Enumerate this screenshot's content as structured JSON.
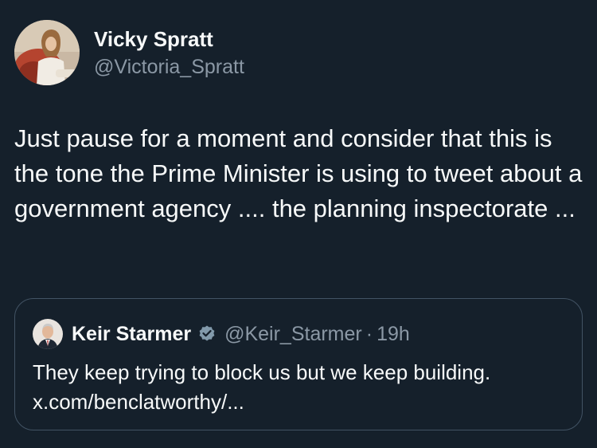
{
  "colors": {
    "background": "#15202b",
    "primary_text": "#f7f9f9",
    "secondary_text": "#8b98a5",
    "card_border": "#425364",
    "verified_badge": "#829aab"
  },
  "tweet": {
    "author": {
      "name": "Vicky Spratt",
      "handle": "@Victoria_Spratt",
      "avatar_icon": "profile-photo"
    },
    "text": "Just pause for a moment and consider that this is the tone the Prime Minister is using to tweet about a government agency .... the planning inspectorate ..."
  },
  "quoted_tweet": {
    "author": {
      "name": "Keir Starmer",
      "handle": "@Keir_Starmer",
      "avatar_icon": "profile-photo",
      "verified_icon": "verified-badge-icon"
    },
    "separator": "·",
    "time": "19h",
    "text": "They keep trying to block us but we keep building.",
    "link": "x.com/benclatworthy/..."
  }
}
